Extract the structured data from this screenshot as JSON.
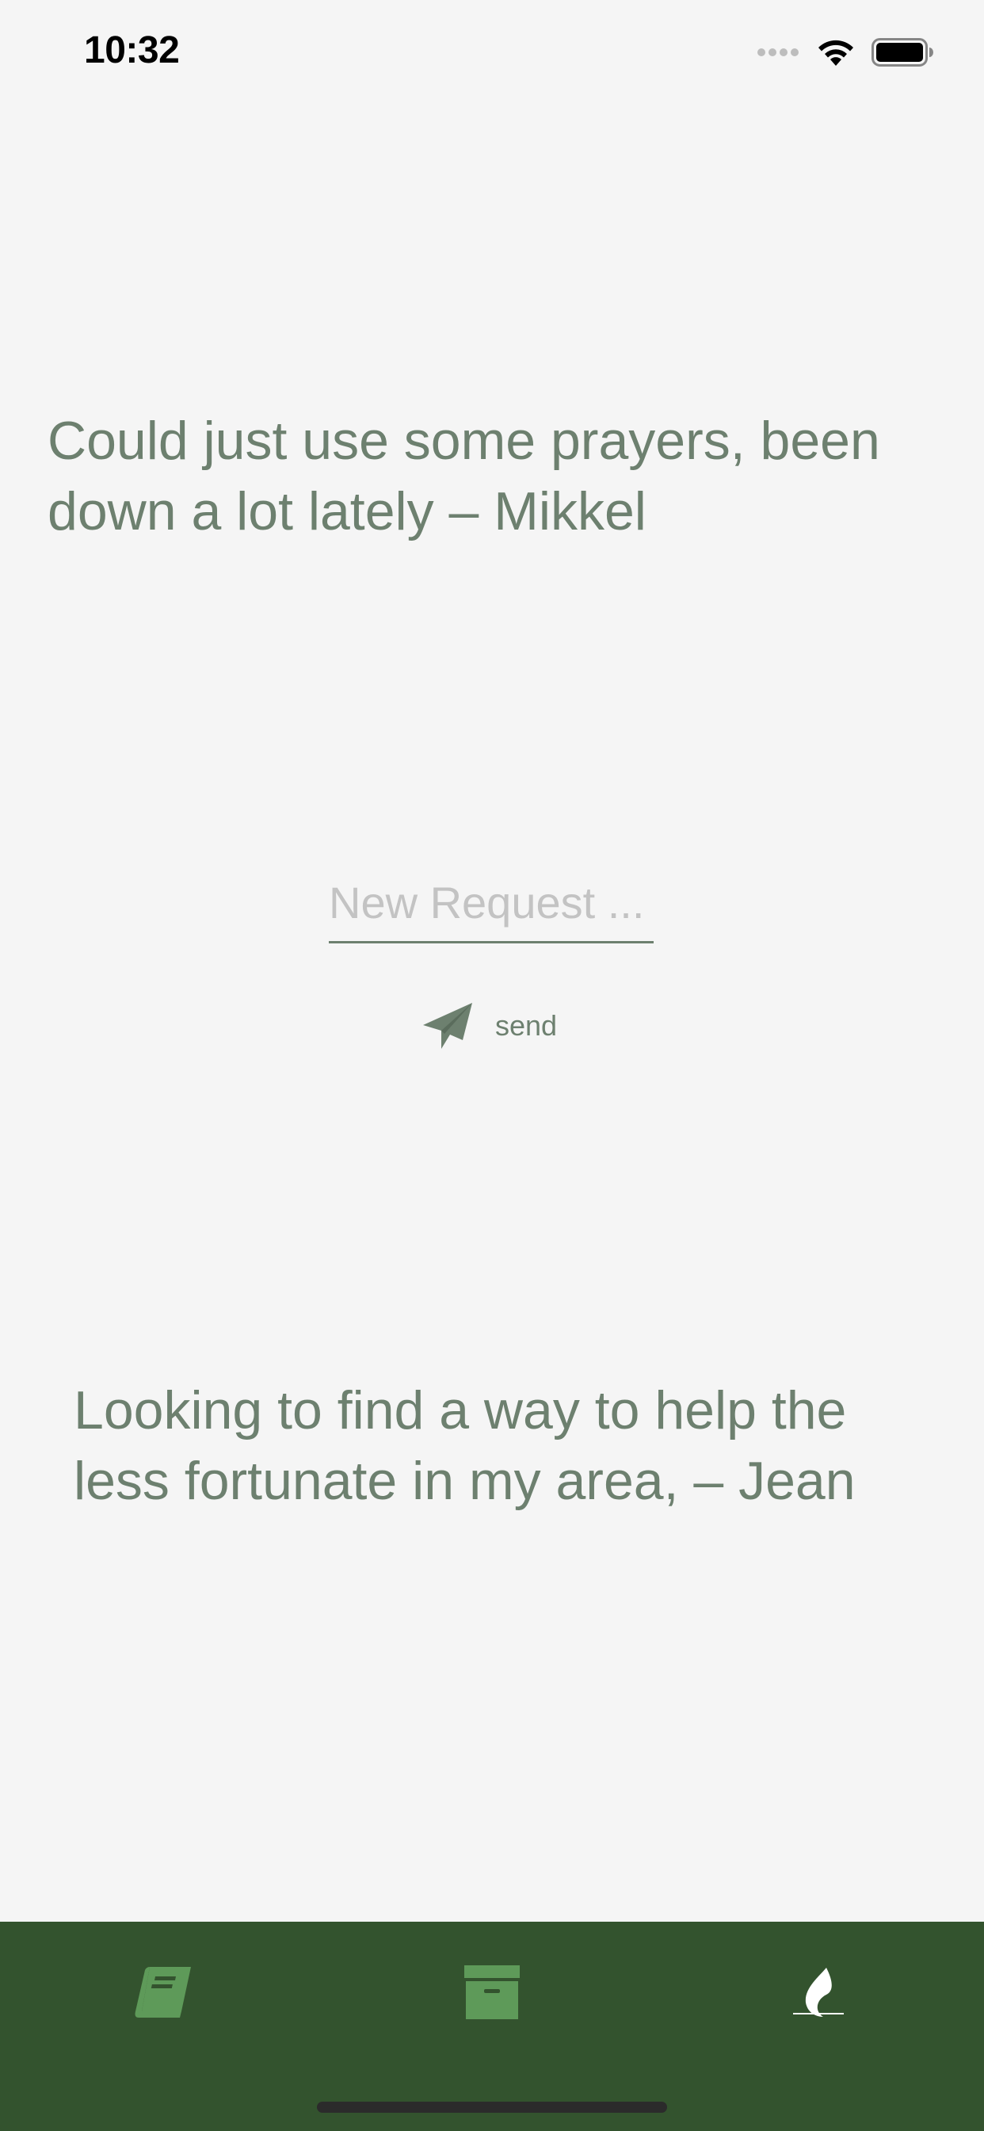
{
  "status_bar": {
    "time": "10:32"
  },
  "prayers": [
    {
      "text": "Could just use some prayers, been down a lot lately – Mikkel"
    },
    {
      "text": "Looking to find a way to help the less fortunate in my area, – Jean"
    }
  ],
  "request_form": {
    "placeholder": "New Request ...",
    "value": "",
    "send_label": "send"
  },
  "tab_bar": {
    "tabs": [
      {
        "icon": "book-icon",
        "active": false
      },
      {
        "icon": "archive-box-icon",
        "active": false
      },
      {
        "icon": "flame-icon",
        "active": true
      }
    ]
  },
  "colors": {
    "background": "#f5f5f5",
    "accent_text": "#6d806f",
    "tab_bar": "#33532e",
    "tab_icon_inactive": "#5e9a59",
    "tab_icon_active": "#ffffff",
    "placeholder": "#c3c3c3"
  }
}
